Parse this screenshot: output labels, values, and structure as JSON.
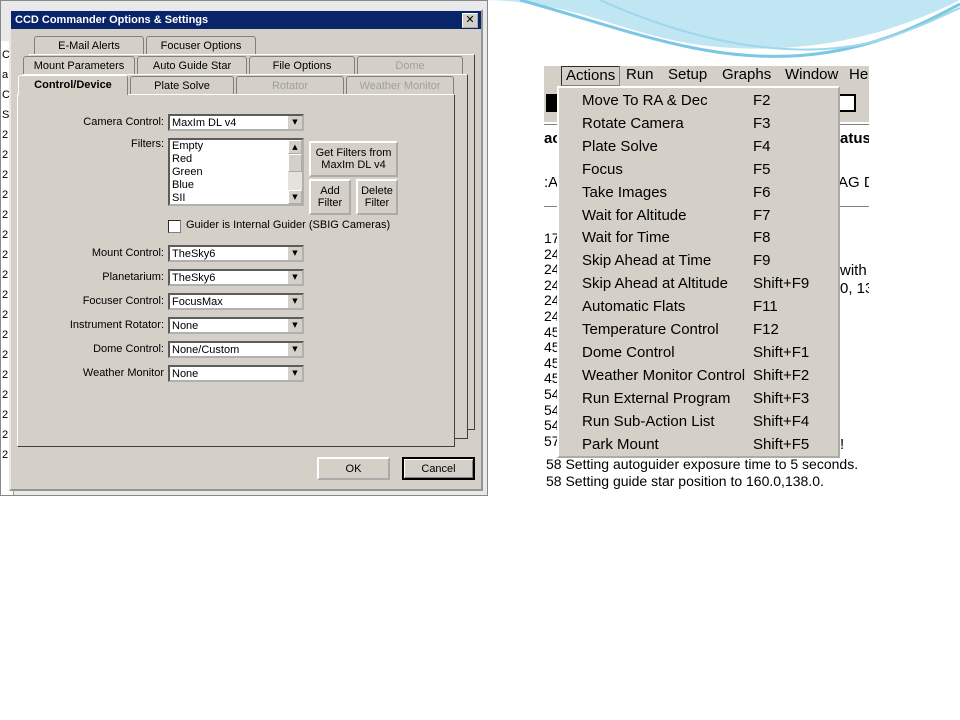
{
  "dialog": {
    "title": "CCD Commander Options & Settings",
    "close": "✕",
    "tabs_back": [
      "E-Mail Alerts",
      "Focuser Options"
    ],
    "tabs_mid": [
      "Mount Parameters",
      "Auto Guide Star",
      "File Options",
      "Dome"
    ],
    "tabs_front": [
      "Control/Device",
      "Plate Solve",
      "Rotator",
      "Weather Monitor"
    ],
    "labels": {
      "camera_control": "Camera Control:",
      "filters": "Filters:",
      "mount_control": "Mount Control:",
      "planetarium": "Planetarium:",
      "focuser_control": "Focuser Control:",
      "instrument_rotator": "Instrument Rotator:",
      "dome_control": "Dome Control:",
      "weather_monitor": "Weather Monitor"
    },
    "values": {
      "camera_control": "MaxIm DL v4",
      "mount_control": "TheSky6",
      "planetarium": "TheSky6",
      "focuser_control": "FocusMax",
      "instrument_rotator": "None",
      "dome_control": "None/Custom",
      "weather_monitor": "None"
    },
    "filters_list": [
      "Empty",
      "Red",
      "Green",
      "Blue",
      "SII"
    ],
    "buttons": {
      "get_filters_1": "Get Filters from",
      "get_filters_2": "MaxIm DL v4",
      "add_1": "Add",
      "add_2": "Filter",
      "delete_1": "Delete",
      "delete_2": "Filter",
      "ok": "OK",
      "cancel": "Cancel"
    },
    "guider_checkbox": "Guider is Internal Guider (SBIG Cameras)",
    "guider_checked": false
  },
  "background_app": {
    "side_chars": [
      "C",
      "a",
      "C",
      "S",
      "2",
      "2",
      "2",
      "2",
      "2",
      "2",
      "2",
      "2",
      "2",
      "2",
      "2",
      "2",
      "2",
      "2",
      "2",
      "2",
      "2"
    ]
  },
  "menu_screenshot": {
    "menubar": [
      "Actions",
      "Run",
      "Setup",
      "Graphs",
      "Window",
      "He"
    ],
    "fragments": {
      "ac": "ac",
      "atus": "atus",
      "a_col": ":A",
      "agd": "AG D",
      "wa": "with a",
      "nums": "0, 13",
      "excl": "!"
    },
    "line_numbers": [
      "17",
      "24",
      "24",
      "24",
      "24",
      "24",
      "45",
      "45",
      "45",
      "45",
      "54",
      "54",
      "54",
      "57"
    ],
    "items": [
      {
        "label": "Move To RA & Dec",
        "shortcut": "F2"
      },
      {
        "label": "Rotate Camera",
        "shortcut": "F3"
      },
      {
        "label": "Plate Solve",
        "shortcut": "F4"
      },
      {
        "label": "Focus",
        "shortcut": "F5"
      },
      {
        "label": "Take Images",
        "shortcut": "F6"
      },
      {
        "label": "Wait for Altitude",
        "shortcut": "F7"
      },
      {
        "label": "Wait for Time",
        "shortcut": "F8"
      },
      {
        "label": "Skip Ahead at Time",
        "shortcut": "F9"
      },
      {
        "label": "Skip Ahead at Altitude",
        "shortcut": "Shift+F9"
      },
      {
        "label": "Automatic Flats",
        "shortcut": "F11"
      },
      {
        "label": "Temperature Control",
        "shortcut": "F12"
      },
      {
        "label": "Dome Control",
        "shortcut": "Shift+F1"
      },
      {
        "label": "Weather Monitor Control",
        "shortcut": "Shift+F2"
      },
      {
        "label": "Run External Program",
        "shortcut": "Shift+F3"
      },
      {
        "label": "Run Sub-Action List",
        "shortcut": "Shift+F4"
      },
      {
        "label": "Park Mount",
        "shortcut": "Shift+F5"
      }
    ],
    "log_lines": [
      "58  Setting autoguider exposure time to 5 seconds.",
      "58  Setting guide star position to 160.0,138.0."
    ]
  }
}
